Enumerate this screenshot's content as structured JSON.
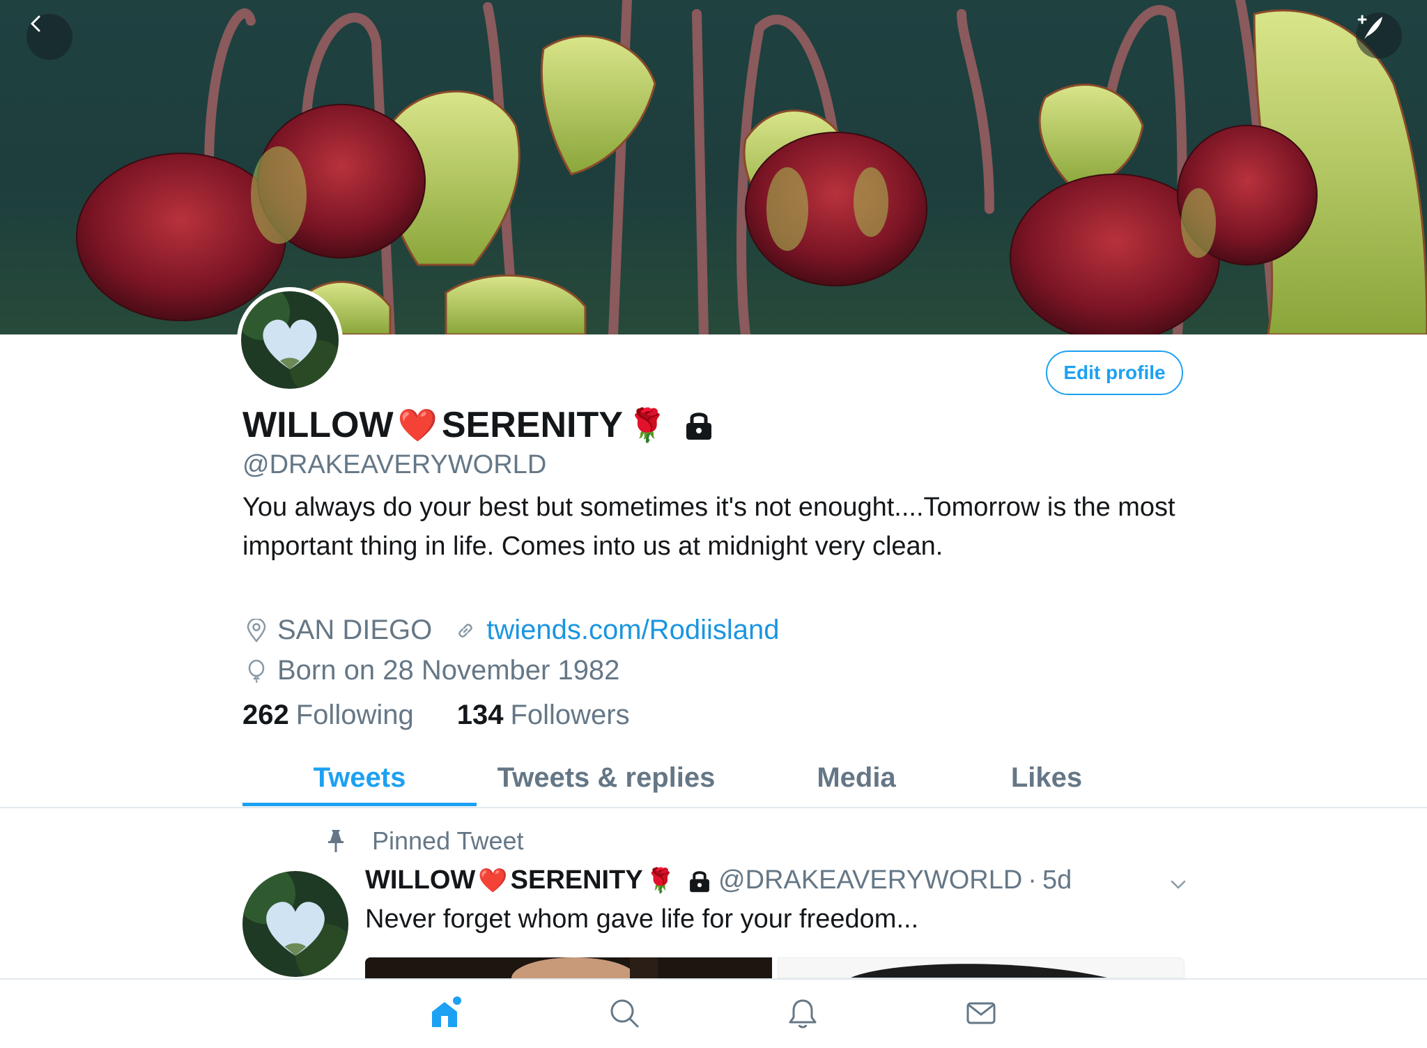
{
  "header": {
    "back_icon": "chevron-left-icon",
    "compose_icon": "compose-feather-icon"
  },
  "profile": {
    "name_part1": "WILLOW",
    "name_heart": "❤️",
    "name_part2": "SERENITY",
    "name_rose": "🌹",
    "lock_icon": "lock-icon",
    "handle": "@DRAKEAVERYWORLD",
    "bio": "You always do your best but sometimes it's not enought....Tomorrow is the most important thing in life. Comes into us at midnight very clean.",
    "location": "SAN DIEGO",
    "website": "twiends.com/Rodiisland",
    "birthday": "Born on 28 November 1982",
    "edit_profile_label": "Edit profile",
    "following_count": "262",
    "following_label": "Following",
    "followers_count": "134",
    "followers_label": "Followers"
  },
  "tabs": [
    {
      "label": "Tweets",
      "active": true
    },
    {
      "label": "Tweets & replies",
      "active": false
    },
    {
      "label": "Media",
      "active": false
    },
    {
      "label": "Likes",
      "active": false
    }
  ],
  "pinned_tweet": {
    "pinned_label": "Pinned Tweet",
    "name_part1": "WILLOW",
    "name_heart": "❤️",
    "name_part2": "SERENITY",
    "name_rose": "🌹",
    "handle": "@DRAKEAVERYWORLD",
    "separator": "·",
    "time": "5d",
    "text": "Never forget whom gave life for your freedom..."
  },
  "bottom_nav": [
    {
      "icon": "home-icon",
      "active": true
    },
    {
      "icon": "search-icon",
      "active": false
    },
    {
      "icon": "bell-icon",
      "active": false
    },
    {
      "icon": "mail-icon",
      "active": false
    }
  ],
  "colors": {
    "accent": "#1da1f2",
    "link": "#1b95e0",
    "secondary_text": "#657786",
    "primary_text": "#14171a"
  }
}
